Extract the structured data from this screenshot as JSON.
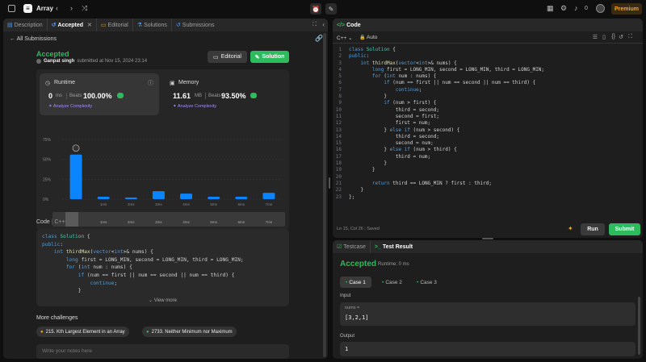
{
  "topbar": {
    "title": "Array",
    "premium": "Premium",
    "coins": "0"
  },
  "left_tabs": [
    {
      "label": "Description",
      "icon": "▤"
    },
    {
      "label": "Accepted",
      "icon": "↺"
    },
    {
      "label": "Editorial",
      "icon": "▭"
    },
    {
      "label": "Solutions",
      "icon": "⚗"
    },
    {
      "label": "Submissions",
      "icon": "↺"
    }
  ],
  "back_label": "All Submissions",
  "submission": {
    "status": "Accepted",
    "author": "Ganpat singh",
    "submitted": "submitted at Nov 15, 2024 23:14",
    "editorial_btn": "Editorial",
    "solution_btn": "Solution"
  },
  "runtime": {
    "label": "Runtime",
    "value": "0",
    "unit": "ms",
    "beats_label": "Beats",
    "beats": "100.00%",
    "analyze": "Analyze Complexity"
  },
  "memory": {
    "label": "Memory",
    "value": "11.61",
    "unit": "MB",
    "beats_label": "Beats",
    "beats": "93.50%",
    "analyze": "Analyze Complexity"
  },
  "chart_data": {
    "type": "bar",
    "ytick_labels": [
      "75%",
      "50%",
      "25%",
      "0%"
    ],
    "categories": [
      "0ms",
      "1ms",
      "2ms",
      "3ms",
      "4ms",
      "5ms",
      "6ms",
      "7ms"
    ],
    "values": [
      56,
      3,
      2,
      10,
      7,
      3,
      3,
      8
    ],
    "ylim": [
      0,
      75
    ],
    "mini_labels": [
      "1ms",
      "2ms",
      "3ms",
      "4ms",
      "5ms",
      "6ms",
      "7ms"
    ],
    "colors": {
      "bar": "#0a84ff",
      "grid": "#3a3a3a"
    }
  },
  "code_header": {
    "label": "Code",
    "lang": "C++"
  },
  "left_code": [
    "class Solution {",
    "public:",
    "    int thirdMax(vector<int>& nums) {",
    "        long first = LONG_MIN, second = LONG_MIN, third = LONG_MIN;",
    "        for (int num : nums) {",
    "            if (num == first || num == second || num == third) {",
    "                continue;",
    "            }"
  ],
  "view_more": "View more",
  "more_challenges": {
    "title": "More challenges",
    "items": [
      "215. Kth Largest Element in an Array",
      "2733. Neither Minimum nor Maximum"
    ]
  },
  "notes_placeholder": "Write your notes here",
  "code_panel": {
    "title": "Code",
    "lang": "C++",
    "auto": "Auto",
    "status": "Ln 15, Col 26",
    "saved": "Saved",
    "run": "Run",
    "submit": "Submit",
    "lines": [
      "class Solution {",
      "public:",
      "    int thirdMax(vector<int>& nums) {",
      "        long first = LONG_MIN, second = LONG_MIN, third = LONG_MIN;",
      "        for (int num : nums) {",
      "            if (num == first || num == second || num == third) {",
      "                continue;",
      "            }",
      "            if (num > first) {",
      "                third = second;",
      "                second = first;",
      "                first = num;",
      "            } else if (num > second) {",
      "                third = second;",
      "                second = num;",
      "            } else if (num > third) {",
      "                third = num;",
      "            }",
      "        }",
      "",
      "        return third == LONG_MIN ? first : third;",
      "    }",
      "};"
    ]
  },
  "test_panel": {
    "tab_testcase": "Testcase",
    "tab_result": "Test Result",
    "status": "Accepted",
    "runtime": "Runtime: 0 ms",
    "cases": [
      "Case 1",
      "Case 2",
      "Case 3"
    ],
    "input_label": "Input",
    "input_var": "nums =",
    "input_value": "[3,2,1]",
    "output_label": "Output",
    "output_value": "1"
  }
}
